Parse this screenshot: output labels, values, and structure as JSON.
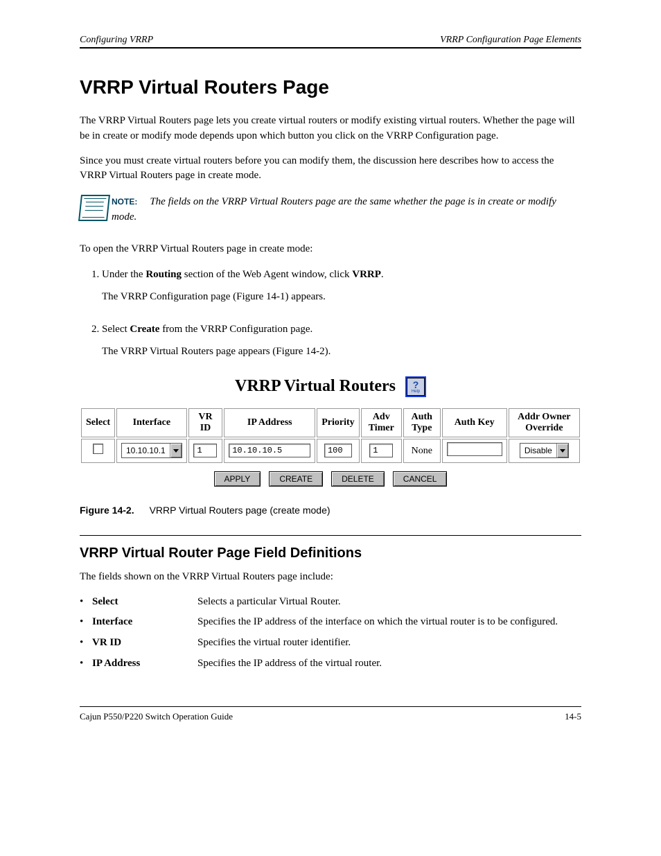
{
  "header": {
    "left": "Configuring VRRP",
    "right": "VRRP Configuration Page Elements"
  },
  "main_heading": "VRRP Virtual Routers Page",
  "intro": {
    "p1": "The VRRP Virtual Routers page lets you create virtual routers or modify existing virtual routers. Whether the page will be in create or modify mode depends upon which button you click on the VRRP Configuration page.",
    "p2": "Since you must create virtual routers before you can modify them, the discussion here describes how to access the VRRP Virtual Routers page in create mode."
  },
  "note": {
    "label": "NOTE:",
    "text": "The fields on the VRRP Virtual Routers page are the same whether the page is in create or modify mode."
  },
  "steps": [
    {
      "step": "Under the Routing section of the Web Agent window, click VRRP.",
      "tail": "The VRRP Configuration page (Figure 14-1) appears."
    },
    {
      "step": "Select Create from the VRRP Configuration page.",
      "tail": "The VRRP Virtual Routers page appears (Figure 14-2)."
    }
  ],
  "figure": {
    "title": "VRRP Virtual Routers",
    "help_char": "?",
    "help_label": "Help",
    "headers": {
      "select": "Select",
      "interface": "Interface",
      "vrid": "VR ID",
      "ip": "IP Address",
      "priority": "Priority",
      "adv": "Adv Timer",
      "authtype": "Auth Type",
      "authkey": "Auth Key",
      "override": "Addr Owner Override"
    },
    "row": {
      "interface": "10.10.10.1",
      "vrid": "1",
      "ip": "10.10.10.5",
      "priority": "100",
      "adv": "1",
      "authtype": "None",
      "authkey": "",
      "override": "Disable"
    },
    "buttons": {
      "apply": "APPLY",
      "create": "CREATE",
      "delete": "DELETE",
      "cancel": "CANCEL"
    },
    "caption_label": "Figure 14-2.",
    "caption_text": "VRRP Virtual Routers page (create mode)"
  },
  "fields_section": {
    "heading": "VRRP Virtual Router Page Field Definitions",
    "intro": "The fields shown on the VRRP Virtual Routers page include:",
    "fields": [
      {
        "name": "Select",
        "desc": "Selects a particular Virtual Router."
      },
      {
        "name": "Interface",
        "desc": "Specifies the IP address of the interface on which the virtual router is to be configured."
      },
      {
        "name": "VR ID",
        "desc": "Specifies the virtual router identifier."
      },
      {
        "name": "IP Address",
        "desc": "Specifies the IP address of the virtual router."
      }
    ]
  },
  "footer": {
    "left": "Cajun P550/P220 Switch Operation Guide",
    "right": "14-5"
  }
}
